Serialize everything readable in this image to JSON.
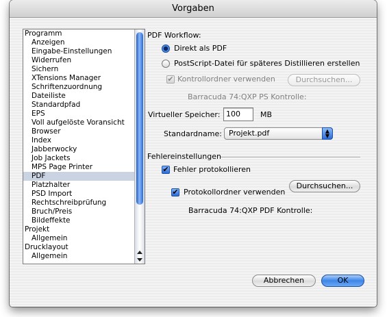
{
  "window": {
    "title": "Vorgaben"
  },
  "sidebar": {
    "items": [
      {
        "label": "Programm",
        "level": "cat"
      },
      {
        "label": "Anzeigen",
        "level": "sub"
      },
      {
        "label": "Eingabe-Einstellungen",
        "level": "sub"
      },
      {
        "label": "Widerrufen",
        "level": "sub"
      },
      {
        "label": "Sichern",
        "level": "sub"
      },
      {
        "label": "XTensions Manager",
        "level": "sub"
      },
      {
        "label": "Schriftenzuordnung",
        "level": "sub"
      },
      {
        "label": "Dateiliste",
        "level": "sub"
      },
      {
        "label": "Standardpfad",
        "level": "sub"
      },
      {
        "label": "EPS",
        "level": "sub"
      },
      {
        "label": "Voll aufgelöste Voransicht",
        "level": "sub"
      },
      {
        "label": "Browser",
        "level": "sub"
      },
      {
        "label": "Index",
        "level": "sub"
      },
      {
        "label": "Jabberwocky",
        "level": "sub"
      },
      {
        "label": "Job Jackets",
        "level": "sub"
      },
      {
        "label": "MPS Page Printer",
        "level": "sub"
      },
      {
        "label": "PDF",
        "level": "sub",
        "selected": true
      },
      {
        "label": "Platzhalter",
        "level": "sub"
      },
      {
        "label": "PSD Import",
        "level": "sub"
      },
      {
        "label": "Rechtschreibprüfung",
        "level": "sub"
      },
      {
        "label": "Bruch/Preis",
        "level": "sub"
      },
      {
        "label": "Bildeffekte",
        "level": "sub"
      },
      {
        "label": "Projekt",
        "level": "cat"
      },
      {
        "label": "Allgemein",
        "level": "sub"
      },
      {
        "label": "Drucklayout",
        "level": "cat"
      },
      {
        "label": "Allgemein",
        "level": "sub"
      }
    ]
  },
  "pdf_workflow": {
    "heading": "PDF Workflow:",
    "radio_direct": "Direkt als PDF",
    "radio_postscript": "PostScript-Datei für späteres Distillieren erstellen",
    "use_folder_label": "Kontrollordner verwenden",
    "browse_label": "Durchsuchen...",
    "folder_path": "Barracuda 74:QXP PS Kontrolle:"
  },
  "virtual_memory": {
    "label": "Virtueller Speicher:",
    "value": "100",
    "unit": "MB"
  },
  "default_name": {
    "label": "Standardname:",
    "value": "Projekt.pdf"
  },
  "errors": {
    "heading": "Fehlereinstellungen",
    "log_errors_label": "Fehler protokollieren",
    "use_log_folder_label": "Protokollordner verwenden",
    "browse_label": "Durchsuchen...",
    "folder_path": "Barracuda 74:QXP PDF Kontrolle:"
  },
  "footer": {
    "cancel_label": "Abbrechen",
    "ok_label": "OK"
  }
}
